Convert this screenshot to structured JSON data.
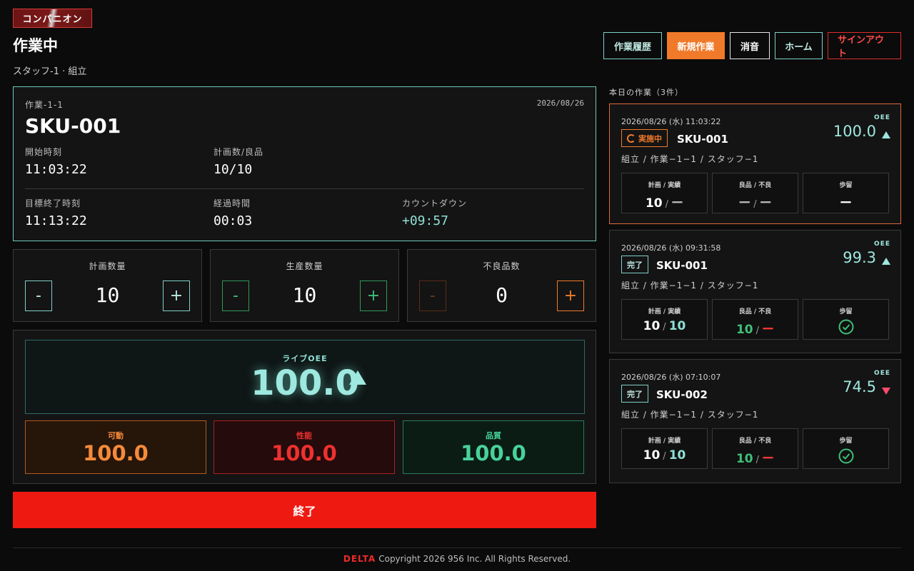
{
  "app": {
    "brand": "コンパニオン",
    "page_title": "作業中",
    "subtitle": "スタッフ-1 · 組立"
  },
  "nav": {
    "history": "作業履歴",
    "new_job": "新規作業",
    "mute": "消音",
    "home": "ホーム",
    "sign_out": "サインアウト"
  },
  "job": {
    "id": "作業-1-1",
    "date": "2026/08/26",
    "sku": "SKU-001",
    "start_label": "開始時刻",
    "start_value": "11:03:22",
    "plan_good_label": "計画数/良品",
    "plan_good_value": "10/10",
    "target_end_label": "目標終了時刻",
    "target_end_value": "11:13:22",
    "elapsed_label": "経過時間",
    "elapsed_value": "00:03",
    "countdown_label": "カウントダウン",
    "countdown_value": "+09:57"
  },
  "counters": [
    {
      "label": "計画数量",
      "value": "10",
      "minus": "-",
      "plus": "+"
    },
    {
      "label": "生産数量",
      "value": "10",
      "minus": "-",
      "plus": "+"
    },
    {
      "label": "不良品数",
      "value": "0",
      "minus": "-",
      "plus": "+"
    }
  ],
  "oee": {
    "live_label": "ライブOEE",
    "live_value": "100.0",
    "trend": "up",
    "availability_label": "可動",
    "availability_value": "100.0",
    "performance_label": "性能",
    "performance_value": "100.0",
    "quality_label": "品質",
    "quality_value": "100.0"
  },
  "finish_label": "終了",
  "today": {
    "label": "本日の作業（3件）",
    "tasks": [
      {
        "datetime": "2026/08/26 (水) 11:03:22",
        "status": "実施中",
        "sku": "SKU-001",
        "path": "組立 / 作業−1−1 / スタッフ−1",
        "oee_label": "OEE",
        "oee": "100.0",
        "trend": "up",
        "plan_actual_label": "計画 / 実績",
        "plan": "10",
        "actual": "ー",
        "good_bad_label": "良品 / 不良",
        "good": "ー",
        "bad": "ー",
        "yield_label": "歩留",
        "yield": "ー",
        "sep": "/"
      },
      {
        "datetime": "2026/08/26 (水) 09:31:58",
        "status": "完了",
        "sku": "SKU-001",
        "path": "組立 / 作業−1−1 / スタッフ−1",
        "oee_label": "OEE",
        "oee": "99.3",
        "trend": "up",
        "plan_actual_label": "計画 / 実績",
        "plan": "10",
        "actual": "10",
        "good_bad_label": "良品 / 不良",
        "good": "10",
        "bad": "ー",
        "yield_label": "歩留",
        "sep": "/"
      },
      {
        "datetime": "2026/08/26 (水) 07:10:07",
        "status": "完了",
        "sku": "SKU-002",
        "path": "組立 / 作業−1−1 / スタッフ−1",
        "oee_label": "OEE",
        "oee": "74.5",
        "trend": "down",
        "plan_actual_label": "計画 / 実績",
        "plan": "10",
        "actual": "10",
        "good_bad_label": "良品 / 不良",
        "good": "10",
        "bad": "ー",
        "yield_label": "歩留",
        "sep": "/"
      }
    ]
  },
  "footer": {
    "brand": "DELTA",
    "text": "Copyright 2026 956 Inc. All Rights Reserved."
  },
  "colors": {
    "accent_teal": "#8fe0d6",
    "accent_orange": "#f07a2a",
    "danger_red": "#ee1a12",
    "success_green": "#3fbf78"
  }
}
